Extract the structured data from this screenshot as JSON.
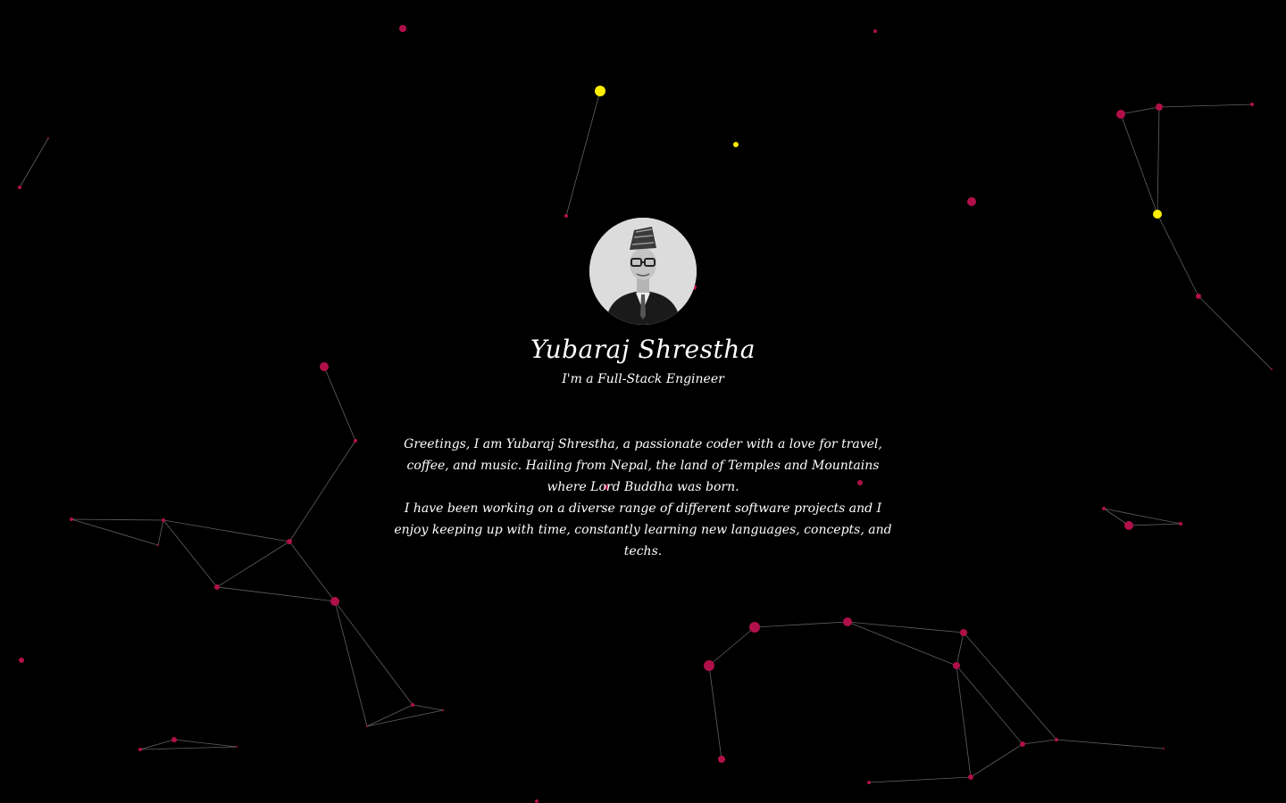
{
  "profile": {
    "name": "Yubaraj Shrestha",
    "tagline": "I'm a Full-Stack Engineer",
    "bio": [
      "Greetings, I am Yubaraj Shrestha, a passionate coder with a love for travel, coffee, and music. Hailing from Nepal, the land of Temples and Mountains where Lord Buddha was born.",
      "I have been working on a diverse range of different software projects and I enjoy keeping up with time, constantly learning new languages, concepts, and techs."
    ]
  },
  "colors": {
    "background": "#000000",
    "text": "#ffffff",
    "particle": "#b0104a",
    "particle_highlight": "#ffee00",
    "link": "#8a8a8a"
  },
  "icons": {
    "avatar": "profile-photo"
  }
}
